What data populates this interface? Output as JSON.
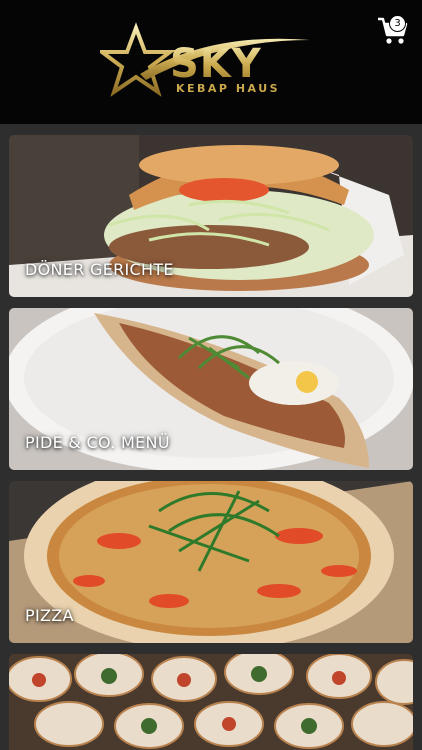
{
  "header": {
    "logo": {
      "brand": "SKY",
      "sub": "KEBAP HAUS"
    },
    "cart": {
      "count": "3"
    }
  },
  "categories": [
    {
      "label": "DÖNER GERICHTE"
    },
    {
      "label": "PIDE & CO. MENÜ"
    },
    {
      "label": "PIZZA"
    },
    {
      "label": ""
    }
  ],
  "colors": {
    "header_bg": "#050505",
    "page_bg": "#2e2e2e",
    "logo_gold": "#c9a84c",
    "label_text": "#ffffff"
  },
  "icons": [
    "star-logo-icon",
    "cart-icon"
  ]
}
